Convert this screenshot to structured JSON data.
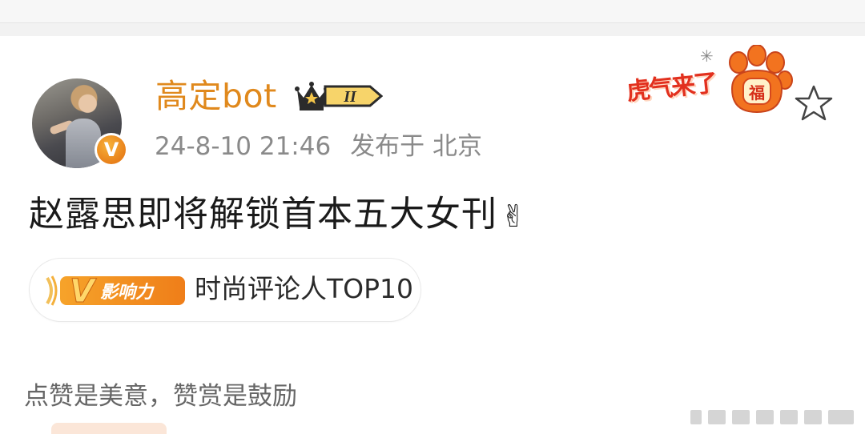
{
  "post": {
    "username": "高定bot",
    "rank_badge": "II",
    "timestamp": "24-8-10 21:46",
    "published_at": "发布于 北京",
    "text": "赵露思即将解锁首本五大女刊",
    "emoji": "✌",
    "decoration_text": "虎气来了",
    "paw_label": "福",
    "verified_mark": "V"
  },
  "influence": {
    "badge_v": "V",
    "badge_text": "影响力",
    "label": "时尚评论人TOP10"
  },
  "footer": {
    "text": "点赞是美意，赞赏是鼓励"
  },
  "colors": {
    "username": "#e0891d",
    "badge_orange": "#f08a1c",
    "tiger_red": "#e2301e"
  },
  "icons": [
    "crown-icon",
    "star-icon",
    "paw-icon",
    "sparkle-icon",
    "verified-icon"
  ]
}
